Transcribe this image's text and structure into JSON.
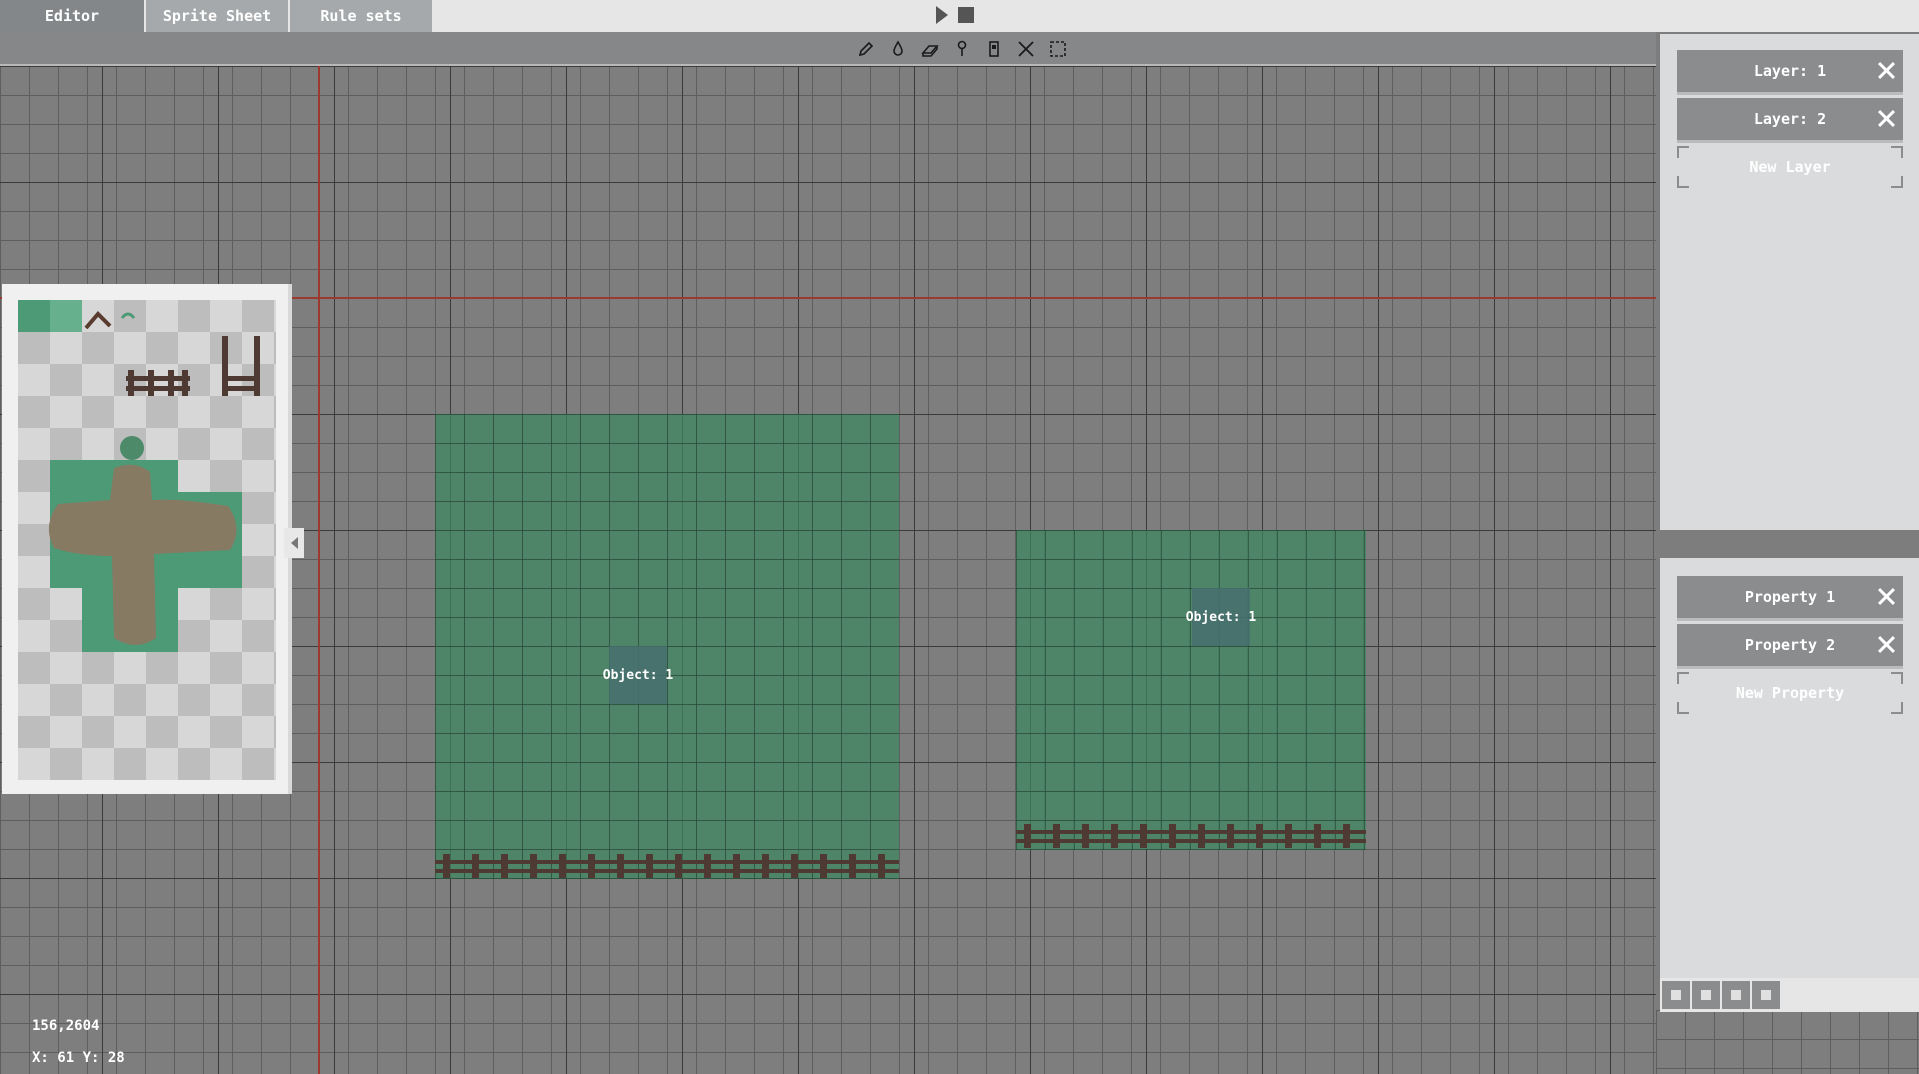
{
  "tabs": [
    {
      "label": "Editor",
      "active": true
    },
    {
      "label": "Sprite Sheet",
      "active": false
    },
    {
      "label": "Rule sets",
      "active": false
    }
  ],
  "controls": {
    "play_icon": "play-icon",
    "stop_icon": "stop-icon"
  },
  "tools": [
    "pencil-icon",
    "bucket-icon",
    "eraser-icon",
    "eyedropper-icon",
    "tile-icon",
    "clear-icon",
    "selection-icon"
  ],
  "canvas": {
    "objects": [
      {
        "label": "Object: 1"
      },
      {
        "label": "Object: 1"
      }
    ],
    "colors": {
      "object_fill": "#3c875f",
      "axis": "#9a3a2e",
      "fence": "#4e3a32"
    }
  },
  "layers": {
    "items": [
      {
        "label": "Layer: 1"
      },
      {
        "label": "Layer: 2"
      }
    ],
    "new_label": "New Layer"
  },
  "properties": {
    "items": [
      {
        "label": "Property 1"
      },
      {
        "label": "Property 2"
      }
    ],
    "new_label": "New Property"
  },
  "status": {
    "position": "156,2604",
    "tile_coords": "X: 61 Y: 28"
  }
}
